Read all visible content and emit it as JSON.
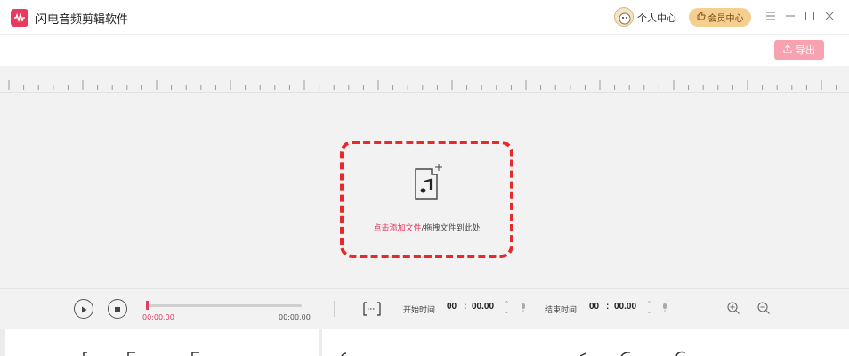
{
  "app": {
    "title": "闪电音频剪辑软件",
    "brand_color": "#e8395f"
  },
  "header": {
    "user_center": "个人中心",
    "vip_center": "会员中心",
    "export_label": "导出"
  },
  "drop_zone": {
    "add_link": "点击添加文件",
    "hint_rest": "/拖拽文件到此处",
    "border_color": "#e62a2a"
  },
  "player": {
    "current_time": "00:00.00",
    "total_time": "00:00.00",
    "progress": 0
  },
  "range": {
    "start_label": "开始时间",
    "start_min": "00",
    "start_sec": "00.00",
    "end_label": "结束时间",
    "end_min": "00",
    "end_sec": "00.00",
    "separator": ":"
  },
  "icons": [
    "audio-wave-icon",
    "avatar-icon",
    "thumb-up-icon",
    "menu-icon",
    "minimize-icon",
    "maximize-icon",
    "close-icon",
    "upload-icon",
    "music-file-icon",
    "play-icon",
    "stop-icon",
    "select-range-icon",
    "mic-icon",
    "zoom-in-icon",
    "zoom-out-icon"
  ]
}
